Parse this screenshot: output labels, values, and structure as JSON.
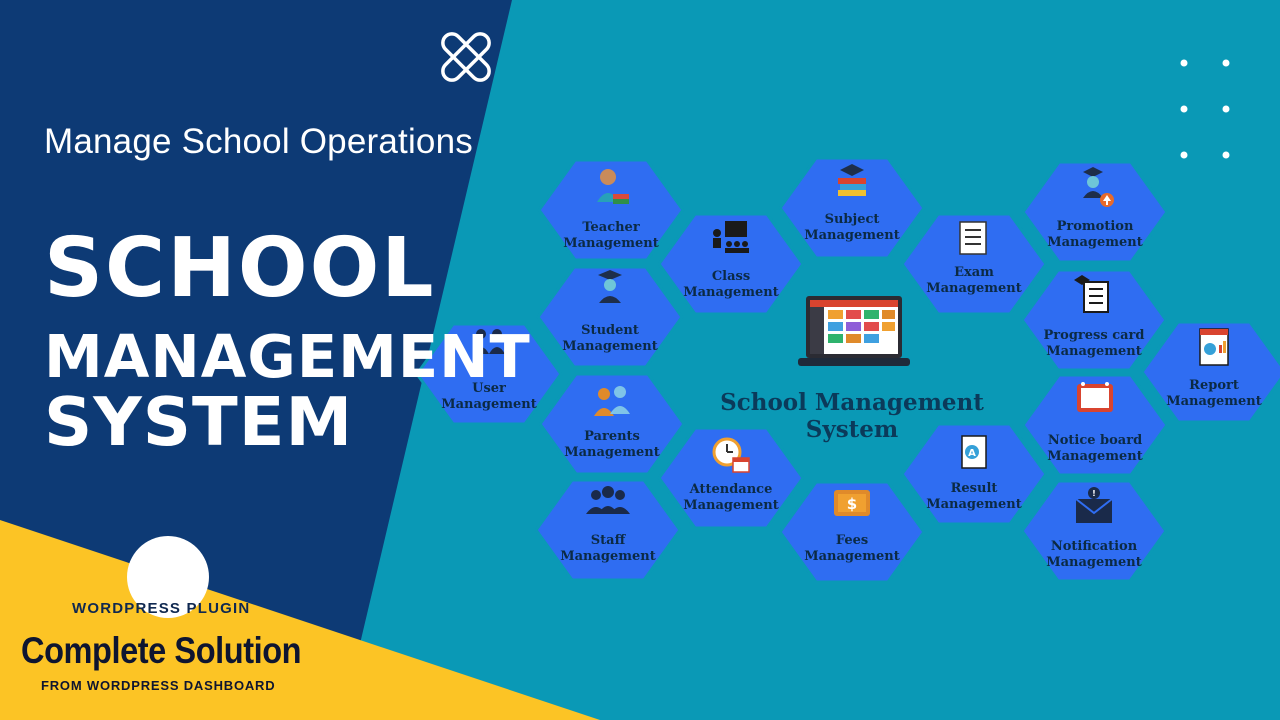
{
  "colors": {
    "teal_background": "#0a99b6",
    "navy_panel": "#0d3a75",
    "hex_blue": "#2f6df2",
    "yellow_band": "#fcc425"
  },
  "headline": {
    "subtitle": "Manage School Operations",
    "line1": "SCHOOL",
    "line2": "MANAGEMENT",
    "line3": "SYSTEM"
  },
  "promo": {
    "eyebrow": "WORDPRESS PLUGIN",
    "title": "Complete Solution",
    "caption": "FROM WORDPRESS DASHBOARD"
  },
  "center": {
    "title_line1": "School Management",
    "title_line2": "System"
  },
  "modules": {
    "teacher": {
      "line1": "Teacher",
      "line2": "Management",
      "icon": "teacher-icon"
    },
    "class": {
      "line1": "Class",
      "line2": "Management",
      "icon": "classroom-icon"
    },
    "subject": {
      "line1": "Subject",
      "line2": "Management",
      "icon": "books-icon"
    },
    "exam": {
      "line1": "Exam",
      "line2": "Management",
      "icon": "exam-sheet-icon"
    },
    "promotion": {
      "line1": "Promotion",
      "line2": "Management",
      "icon": "graduate-up-icon"
    },
    "student": {
      "line1": "Student",
      "line2": "Management",
      "icon": "graduate-student-icon"
    },
    "progress": {
      "line1": "Progress card",
      "line2": "Management",
      "icon": "progress-card-icon"
    },
    "user": {
      "line1": "User",
      "line2": "Management",
      "icon": "users-icon"
    },
    "report": {
      "line1": "Report",
      "line2": "Management",
      "icon": "report-icon"
    },
    "parents": {
      "line1": "Parents",
      "line2": "Management",
      "icon": "parents-icon"
    },
    "notice": {
      "line1": "Notice board",
      "line2": "Management",
      "icon": "notice-board-icon"
    },
    "attendance": {
      "line1": "Attendance",
      "line2": "Management",
      "icon": "attendance-clock-icon"
    },
    "result": {
      "line1": "Result",
      "line2": "Management",
      "icon": "result-grade-icon"
    },
    "staff": {
      "line1": "Staff",
      "line2": "Management",
      "icon": "staff-group-icon"
    },
    "fees": {
      "line1": "Fees",
      "line2": "Management",
      "icon": "fees-dollar-icon"
    },
    "notification": {
      "line1": "Notification",
      "line2": "Management",
      "icon": "notification-envelope-icon"
    }
  }
}
